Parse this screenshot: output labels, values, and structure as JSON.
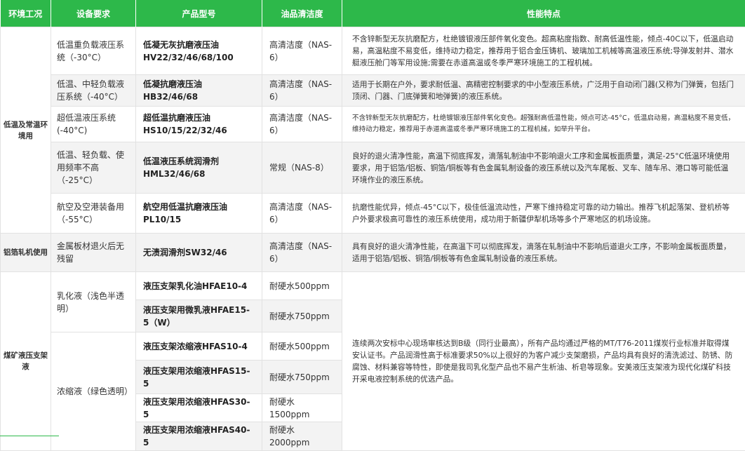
{
  "header": {
    "env": "环境工况",
    "req": "设备要求",
    "model": "产品型号",
    "clean": "油品清洁度",
    "feat": "性能特点"
  },
  "groups": {
    "low_temp": "低温及常温环境用",
    "foil": "铝箔轧机使用",
    "coal": "煤矿液压支架液"
  },
  "rows": [
    {
      "req": "低温重负载液压系统（-30°C）",
      "model": "低凝无灰抗磨液压油HV22/32/46/68/100",
      "clean": "高清洁度（NAS-6）",
      "feat": "不含锌新型无灰抗磨配方，杜绝镀银液压部件氧化变色。超高粘度指数、耐高低温性能，倾点-40C以下，低温启动易，高温粘度不易变低，维持动力稳定，推荐用于铝合金压铸机、玻璃加工机械等高温液压系统;导弹发射井、潜水艇液压舱门等军用设施;需要在赤道高温或冬季严寒环境施工的工程机械。"
    },
    {
      "req": "低温、中轻负载液压系统（-40°C）",
      "model": "低凝抗磨液压油HB32/46/68",
      "clean": "高清洁度（NAS-6）",
      "feat": "适用于长期在户外，要求耐低温、高精密控制要求的中小型液压系统，广泛用于自动闭门器(又称为门弹簧，包括门顶闭、门器、门底弹簧和地弹簧)的液压系统。"
    },
    {
      "req": "超低温液压系统(-40°C)",
      "model": "超低温抗磨液压油HS10/15/22/32/46",
      "clean": "高清洁度（NAS-6）",
      "feat": "不含锌新型无灰抗磨配方，杜绝镀银液压部件氧化变色。超强耐高低温性能，倾点可达-45°C，低温启动易，高温粘度不易变低，维持动力稳定，推荐用于赤道高温或冬季严寒环境施工的工程机械，如举升平台。"
    },
    {
      "req": "低温、轻负载、使用频率不高（-25°C）",
      "model": "低温液压系统润滑剂HML32/46/68",
      "clean": "常规（NAS-8）",
      "feat": "良好的退火清净性能，高温下彻底挥发，滴落轧制油中不影响退火工序和金属板面质量，满足-25°C低温环境使用要求，用于铝箔/铝板、铜箔/铜板等有色金属轧制设备的液压系统以及汽车尾板、叉车、随车吊、港口等可能低温环境作业的液压系统。"
    },
    {
      "req": "航空及空港装备用（-55°C）",
      "model": "航空用低温抗磨液压油PL10/15",
      "clean": "高清洁度（NAS-6）",
      "feat": "抗磨性能优异，倾点-45°C以下，极佳低温流动性，严寒下维持稳定可靠的动力输出。推荐飞机起落架、登机桥等户外要求极高可靠性的液压系统使用，成功用于新疆伊犁机场等多个严寒地区的机场设施。"
    },
    {
      "req": "金属板材退火后无残留",
      "model": "无渍润滑剂SW32/46",
      "clean": "高清洁度（NAS-6）",
      "feat": "具有良好的退火清净性能，在高温下可以彻底挥发，滴落在轧制油中不影响后道退火工序，不影响金属板面质量，适用于铝箔/铝板、铜箔/铜板等有色金属轧制设备的液压系统。"
    }
  ],
  "coal": {
    "req_emulsion": "乳化液（浅色半透明）",
    "req_concentrate": "浓缩液（绿色透明）",
    "feat": "连续两次安标中心现场审核达到B级（同行业最高），所有产品均通过严格的MT/T76-2011煤炭行业标准并取得煤安认证书。产品润滑性高于标准要求50%以上很好的为客户减少支架磨损，产品均具有良好的清洗滤过、防锈、防腐蚀、材料兼容等特性，即使是我司乳化型产品也不易产生析油、析皂等现象。安美液压支架液为现代化煤矿科技开采电液控制系统的优选产品。",
    "items": [
      {
        "model": "液压支架乳化油HFAE10-4",
        "clean": "耐硬水500ppm"
      },
      {
        "model": "液压支架用微乳液HFAE15-5（W）",
        "clean": "耐硬水750ppm"
      },
      {
        "model": "液压支架浓缩液HFAS10-4",
        "clean": "耐硬水500ppm"
      },
      {
        "model": "液压支架用浓缩液HFAS15-5",
        "clean": "耐硬水750ppm"
      },
      {
        "model": "液压支架用浓缩液HFAS30-5",
        "clean": "耐硬水1500ppm"
      },
      {
        "model": "液压支架用浓缩液HFAS40-5",
        "clean": "耐硬水2000ppm"
      }
    ]
  },
  "colors": {
    "header_bg": "#2db84a",
    "stripe_bg": "#f3f3f3",
    "border": "#e2e2e2"
  }
}
